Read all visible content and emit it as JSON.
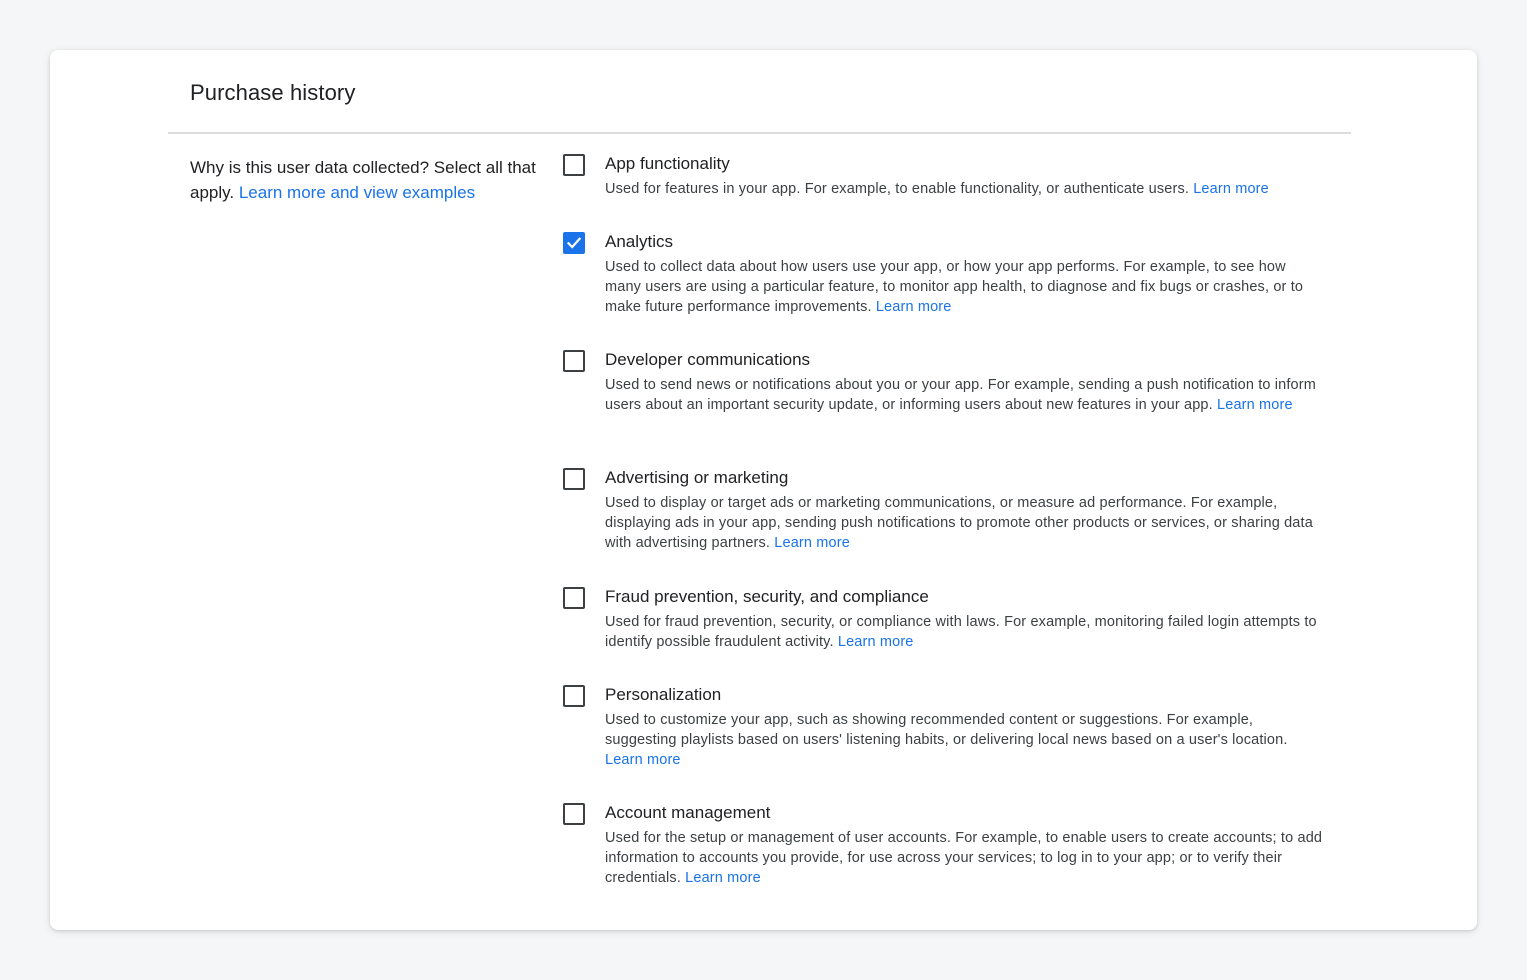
{
  "section": {
    "title": "Purchase history",
    "question": "Why is this user data collected? Select all that apply.",
    "question_link": "Learn more and view examples"
  },
  "options": [
    {
      "title": "App functionality",
      "checked": false,
      "description": "Used for features in your app. For example, to enable functionality, or authenticate users.",
      "link": "Learn more"
    },
    {
      "title": "Analytics",
      "checked": true,
      "description": "Used to collect data about how users use your app, or how your app performs. For example, to see how many users are using a particular feature, to monitor app health, to diagnose and fix bugs or crashes, or to make future performance improvements.",
      "link": "Learn more"
    },
    {
      "title": "Developer communications",
      "checked": false,
      "description": "Used to send news or notifications about you or your app. For example, sending a push notification to inform users about an important security update, or informing users about new features in your app.",
      "link": "Learn more"
    },
    {
      "title": "Advertising or marketing",
      "checked": false,
      "description": "Used to display or target ads or marketing communications, or measure ad performance. For example, displaying ads in your app, sending push notifications to promote other products or services, or sharing data with advertising partners.",
      "link": "Learn more"
    },
    {
      "title": "Fraud prevention, security, and compliance",
      "checked": false,
      "description": "Used for fraud prevention, security, or compliance with laws. For example, monitoring failed login attempts to identify possible fraudulent activity.",
      "link": "Learn more"
    },
    {
      "title": "Personalization",
      "checked": false,
      "description": "Used to customize your app, such as showing recommended content or suggestions. For example, suggesting playlists based on users' listening habits, or delivering local news based on a user's location.",
      "link": "Learn more"
    },
    {
      "title": "Account management",
      "checked": false,
      "description": "Used for the setup or management of user accounts. For example, to enable users to create accounts; to add information to accounts you provide, for use across your services; to log in to your app; or to verify their credentials.",
      "link": "Learn more"
    }
  ],
  "colors": {
    "accent": "#1a73e8",
    "background": "#f5f6f7",
    "card": "#ffffff",
    "divider": "#dadce0"
  }
}
